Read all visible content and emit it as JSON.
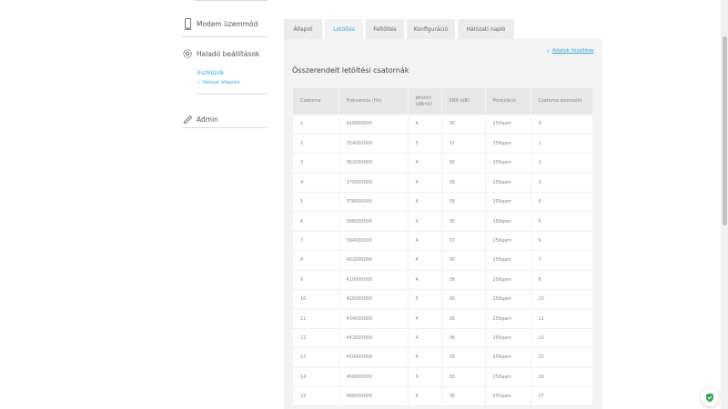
{
  "sidebar": {
    "modem_mode_label": "Modem üzemmód",
    "advanced_label": "Haladó beállítások",
    "devices_label": "Eszközök",
    "network_status_label": "Hálózat állapota",
    "admin_label": "Admin"
  },
  "tabs": [
    {
      "label": "Állapot"
    },
    {
      "label": "Letöltés"
    },
    {
      "label": "Feltöltés"
    },
    {
      "label": "Konfiguráció"
    },
    {
      "label": "Hálózati napló"
    }
  ],
  "active_tab": "Letöltés",
  "export_link": "Adatok frissítése",
  "panel_title": "Összerendelt letöltési csatornák",
  "table": {
    "headers": [
      "Csatorna",
      "Frekvencia (Hz)",
      "Jelszint (dBmV)",
      "SNR (dB)",
      "Moduláció",
      "Csatorna azonosító"
    ],
    "rows": [
      [
        "1",
        "418000000",
        "4",
        "36",
        "256qam",
        "9"
      ],
      [
        "2",
        "354000000",
        "5",
        "37",
        "256qam",
        "1"
      ],
      [
        "3",
        "362000000",
        "4",
        "36",
        "256qam",
        "2"
      ],
      [
        "4",
        "370000000",
        "4",
        "36",
        "256qam",
        "3"
      ],
      [
        "5",
        "378000000",
        "4",
        "36",
        "256qam",
        "4"
      ],
      [
        "6",
        "386000000",
        "4",
        "36",
        "256qam",
        "5"
      ],
      [
        "7",
        "394000000",
        "4",
        "37",
        "256qam",
        "6"
      ],
      [
        "8",
        "402000000",
        "4",
        "36",
        "256qam",
        "7"
      ],
      [
        "9",
        "410000000",
        "4",
        "36",
        "256qam",
        "8"
      ],
      [
        "10",
        "426000000",
        "5",
        "36",
        "256qam",
        "10"
      ],
      [
        "11",
        "434000000",
        "4",
        "36",
        "256qam",
        "11"
      ],
      [
        "12",
        "442000000",
        "4",
        "36",
        "256qam",
        "12"
      ],
      [
        "13",
        "450000000",
        "4",
        "36",
        "256qam",
        "25"
      ],
      [
        "14",
        "458000000",
        "5",
        "36",
        "256qam",
        "26"
      ],
      [
        "15",
        "466000000",
        "5",
        "36",
        "256qam",
        "27"
      ]
    ]
  },
  "colors": {
    "accent": "#3aa7d6",
    "panel_bg": "#f3f3f3",
    "header_bg": "#e7e7e7",
    "shield": "#3fa65a"
  }
}
